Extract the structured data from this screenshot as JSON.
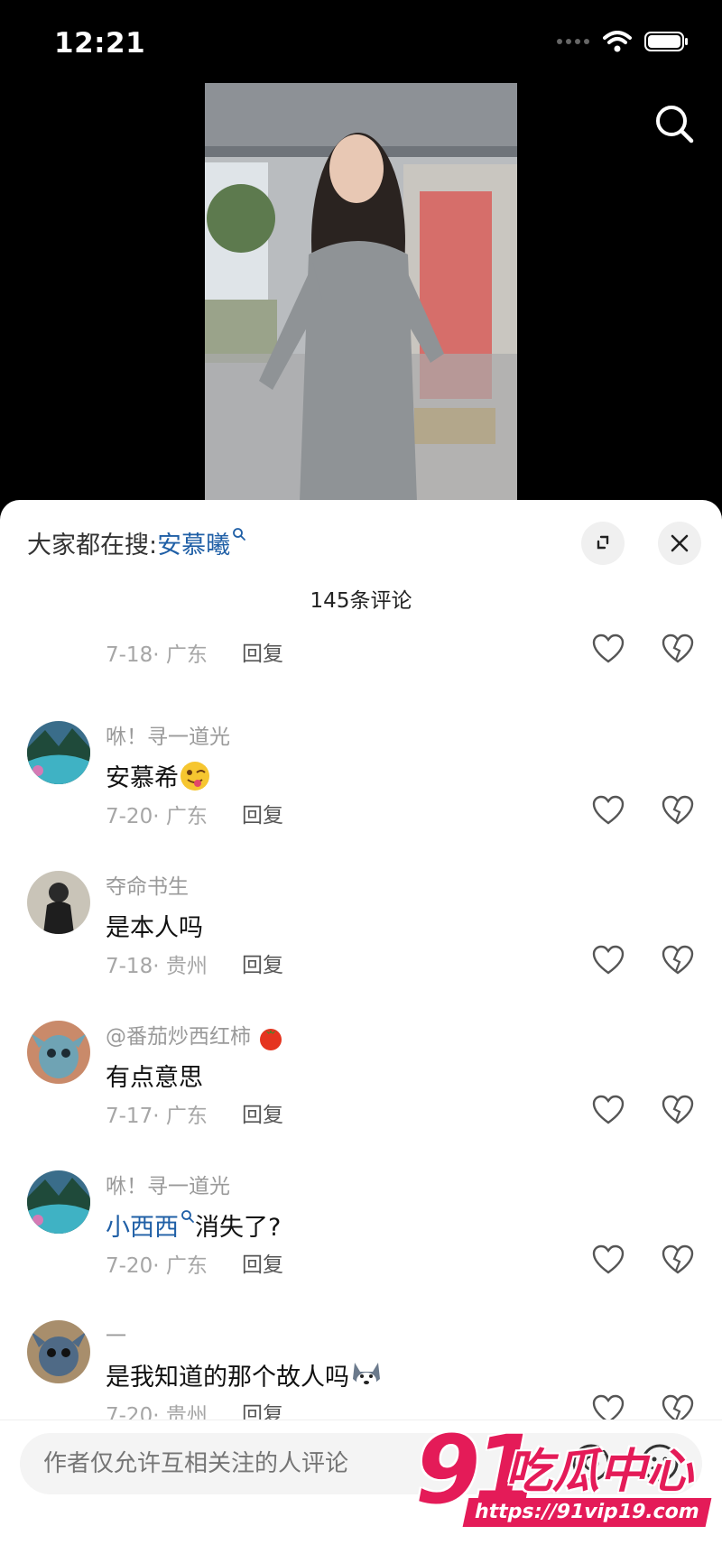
{
  "status_bar": {
    "time": "12:21"
  },
  "header": {
    "trending_prefix": "大家都在搜:",
    "trending_term": "安慕曦"
  },
  "comments_header": {
    "count_text": "145条评论"
  },
  "comments": [
    {
      "username": "",
      "text": "",
      "date": "7-18",
      "location": "广东",
      "reply": "回复"
    },
    {
      "username": "咻！寻一道光",
      "text": "安慕希",
      "date": "7-20",
      "location": "广东",
      "reply": "回复",
      "emoji": "face-with-tongue-emoji"
    },
    {
      "username": "夺命书生",
      "text": "是本人吗",
      "date": "7-18",
      "location": "贵州",
      "reply": "回复"
    },
    {
      "username": "@番茄炒西红柿",
      "text": "有点意思",
      "date": "7-17",
      "location": "广东",
      "reply": "回复",
      "name_emoji": "tomato-emoji"
    },
    {
      "username": "咻！寻一道光",
      "text_link": "小西西",
      "text": "消失了?",
      "date": "7-20",
      "location": "广东",
      "reply": "回复"
    },
    {
      "username": "一",
      "text": "是我知道的那个故人吗",
      "date": "7-20",
      "location": "贵州",
      "reply": "回复",
      "emoji": "husky-dog-emoji"
    }
  ],
  "input": {
    "placeholder": "作者仅允许互相关注的人评论"
  },
  "watermark": {
    "number": "91",
    "brand": "吃瓜中心",
    "url": "https://91vip19.com"
  },
  "colors": {
    "accent_link": "#1f5fa6",
    "watermark": "#e41b58"
  }
}
